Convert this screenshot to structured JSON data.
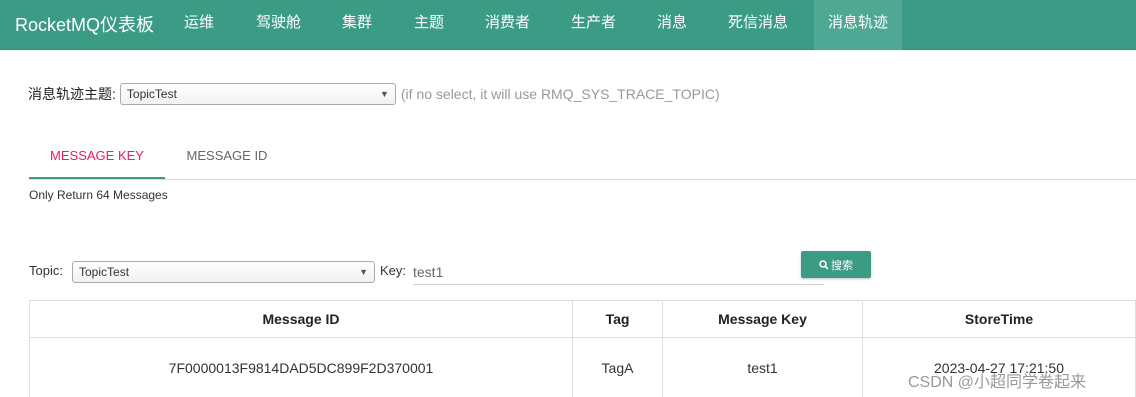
{
  "navbar": {
    "brand": "RocketMQ仪表板",
    "items": [
      "运维",
      "驾驶舱",
      "集群",
      "主题",
      "消费者",
      "生产者",
      "消息",
      "死信消息",
      "消息轨迹"
    ],
    "active_item": "消息轨迹"
  },
  "trace_topic": {
    "label": "消息轨迹主题:",
    "selected": "TopicTest",
    "hint": "(if no select, it will use RMQ_SYS_TRACE_TOPIC)"
  },
  "tabs": [
    {
      "label": "MESSAGE KEY",
      "active": true
    },
    {
      "label": "MESSAGE ID",
      "active": false
    }
  ],
  "info_text": "Only Return 64 Messages",
  "search": {
    "topic_label": "Topic:",
    "topic_selected": "TopicTest",
    "key_label": "Key:",
    "key_value": "test1",
    "button_label": "搜索"
  },
  "table": {
    "headers": [
      "Message ID",
      "Tag",
      "Message Key",
      "StoreTime"
    ],
    "rows": [
      [
        "7F0000013F9814DAD5DC899F2D370001",
        "TagA",
        "test1",
        "2023-04-27 17:21:50"
      ]
    ]
  },
  "watermark": "CSDN @小超同学卷起来",
  "colors": {
    "accent": "#3c9b84",
    "tab_active_text": "#e91e63"
  }
}
